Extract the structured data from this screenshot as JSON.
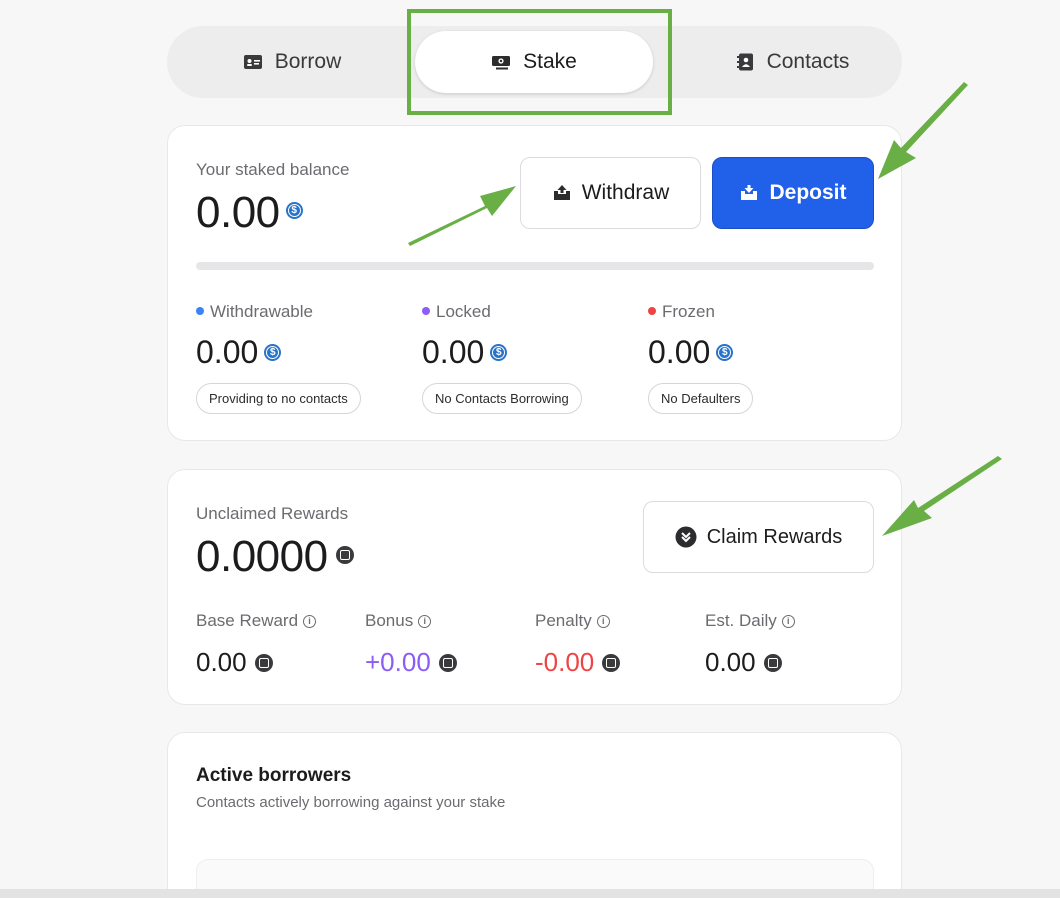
{
  "tabs": [
    {
      "label": "Borrow",
      "icon": "id-card-icon"
    },
    {
      "label": "Stake",
      "icon": "cash-icon",
      "active": true
    },
    {
      "label": "Contacts",
      "icon": "address-book-icon"
    }
  ],
  "staked": {
    "title": "Your staked balance",
    "balance": "0.00",
    "withdraw_label": "Withdraw",
    "deposit_label": "Deposit",
    "progress": 0,
    "stats": [
      {
        "label": "Withdrawable",
        "value": "0.00",
        "pill": "Providing to no contacts",
        "color": "#3b82f6"
      },
      {
        "label": "Locked",
        "value": "0.00",
        "pill": "No Contacts Borrowing",
        "color": "#8b5cf6"
      },
      {
        "label": "Frozen",
        "value": "0.00",
        "pill": "No Defaulters",
        "color": "#ef4444"
      }
    ]
  },
  "rewards": {
    "title": "Unclaimed Rewards",
    "amount": "0.0000",
    "claim_label": "Claim Rewards",
    "stats": [
      {
        "label": "Base Reward",
        "value": "0.00",
        "color": "#1c1c1e"
      },
      {
        "label": "Bonus",
        "value": "+0.00",
        "color": "#8b5cf6"
      },
      {
        "label": "Penalty",
        "value": "-0.00",
        "color": "#ef4444"
      },
      {
        "label": "Est. Daily",
        "value": "0.00",
        "color": "#1c1c1e"
      }
    ]
  },
  "borrowers": {
    "title": "Active borrowers",
    "subtitle": "Contacts actively borrowing against your stake"
  },
  "colors": {
    "accent": "#2160e8",
    "annotation": "#6aae46"
  }
}
